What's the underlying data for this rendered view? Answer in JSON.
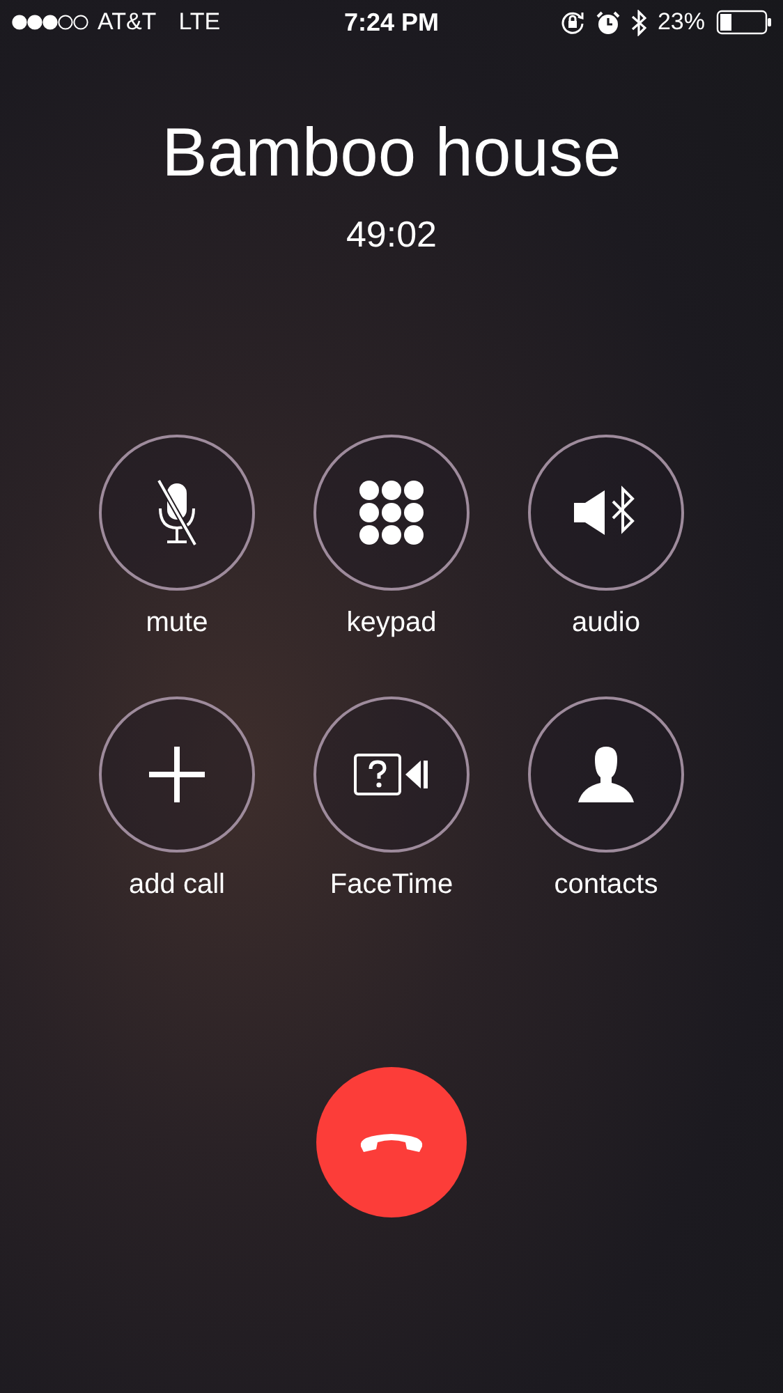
{
  "status_bar": {
    "carrier": "AT&T",
    "network": "LTE",
    "time": "7:24 PM",
    "battery": "23%"
  },
  "call": {
    "name": "Bamboo house",
    "duration": "49:02"
  },
  "buttons": [
    {
      "kind": "mute",
      "label": "mute"
    },
    {
      "kind": "keypad",
      "label": "keypad"
    },
    {
      "kind": "audio",
      "label": "audio"
    },
    {
      "kind": "add",
      "label": "add call"
    },
    {
      "kind": "facetime",
      "label": "FaceTime"
    },
    {
      "kind": "contacts",
      "label": "contacts"
    }
  ]
}
